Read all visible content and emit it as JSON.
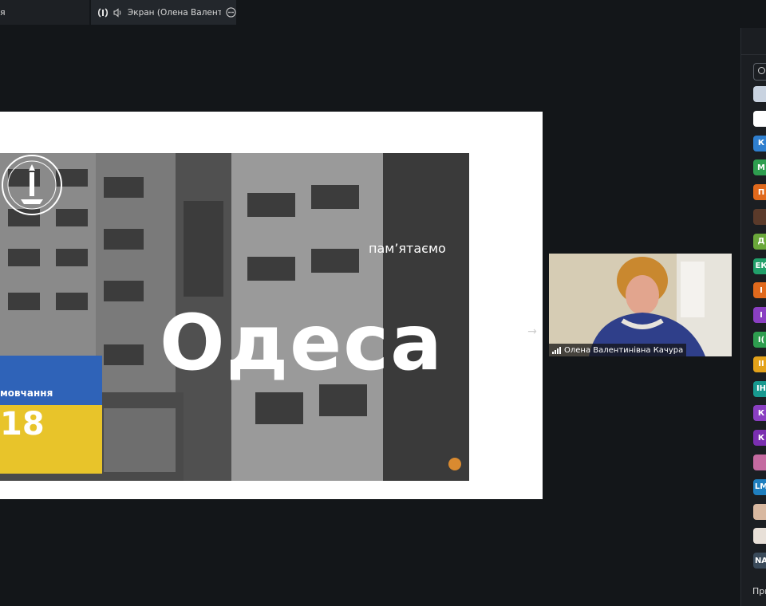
{
  "tabs": {
    "prev_title": "я",
    "active_title": "Экран (Олена Валентинівна"
  },
  "slide": {
    "city": "Одеса",
    "remember": "пам’ятаємо",
    "flag_text": "мовчання",
    "flag_number": "18"
  },
  "video": {
    "name": "Олена Валентинівна Качура"
  },
  "participants": {
    "avatars": [
      {
        "initials": "",
        "color": "#c9d3e0",
        "kind": "photo"
      },
      {
        "initials": "",
        "color": "#ffffff",
        "kind": "photo"
      },
      {
        "initials": "К",
        "color": "#2f7fcf"
      },
      {
        "initials": "М",
        "color": "#2e9e4f"
      },
      {
        "initials": "П",
        "color": "#e0691c"
      },
      {
        "initials": "",
        "color": "#5a3a2a",
        "kind": "photo"
      },
      {
        "initials": "Д",
        "color": "#6aa83a"
      },
      {
        "initials": "ЕК",
        "color": "#21a06a"
      },
      {
        "initials": "І",
        "color": "#e0691c"
      },
      {
        "initials": "І",
        "color": "#8a3fc2"
      },
      {
        "initials": "І(",
        "color": "#2e9e4f"
      },
      {
        "initials": "ІІ",
        "color": "#e3a21a"
      },
      {
        "initials": "ІН",
        "color": "#17998f"
      },
      {
        "initials": "К",
        "color": "#8a3fc2"
      },
      {
        "initials": "К",
        "color": "#7a2fb0"
      },
      {
        "initials": "",
        "color": "#c46aa0",
        "kind": "photo"
      },
      {
        "initials": "LM",
        "color": "#1f7fbf"
      },
      {
        "initials": "",
        "color": "#d8b8a0",
        "kind": "photo"
      },
      {
        "initials": "",
        "color": "#e8e0d8",
        "kind": "photo"
      },
      {
        "initials": "NA",
        "color": "#3a4a5a"
      }
    ],
    "footer_label": "При"
  },
  "colors": {
    "background": "#131619",
    "panel": "#1b1e22",
    "flag_blue": "#2f63b8",
    "flag_yellow": "#e8c42a"
  }
}
